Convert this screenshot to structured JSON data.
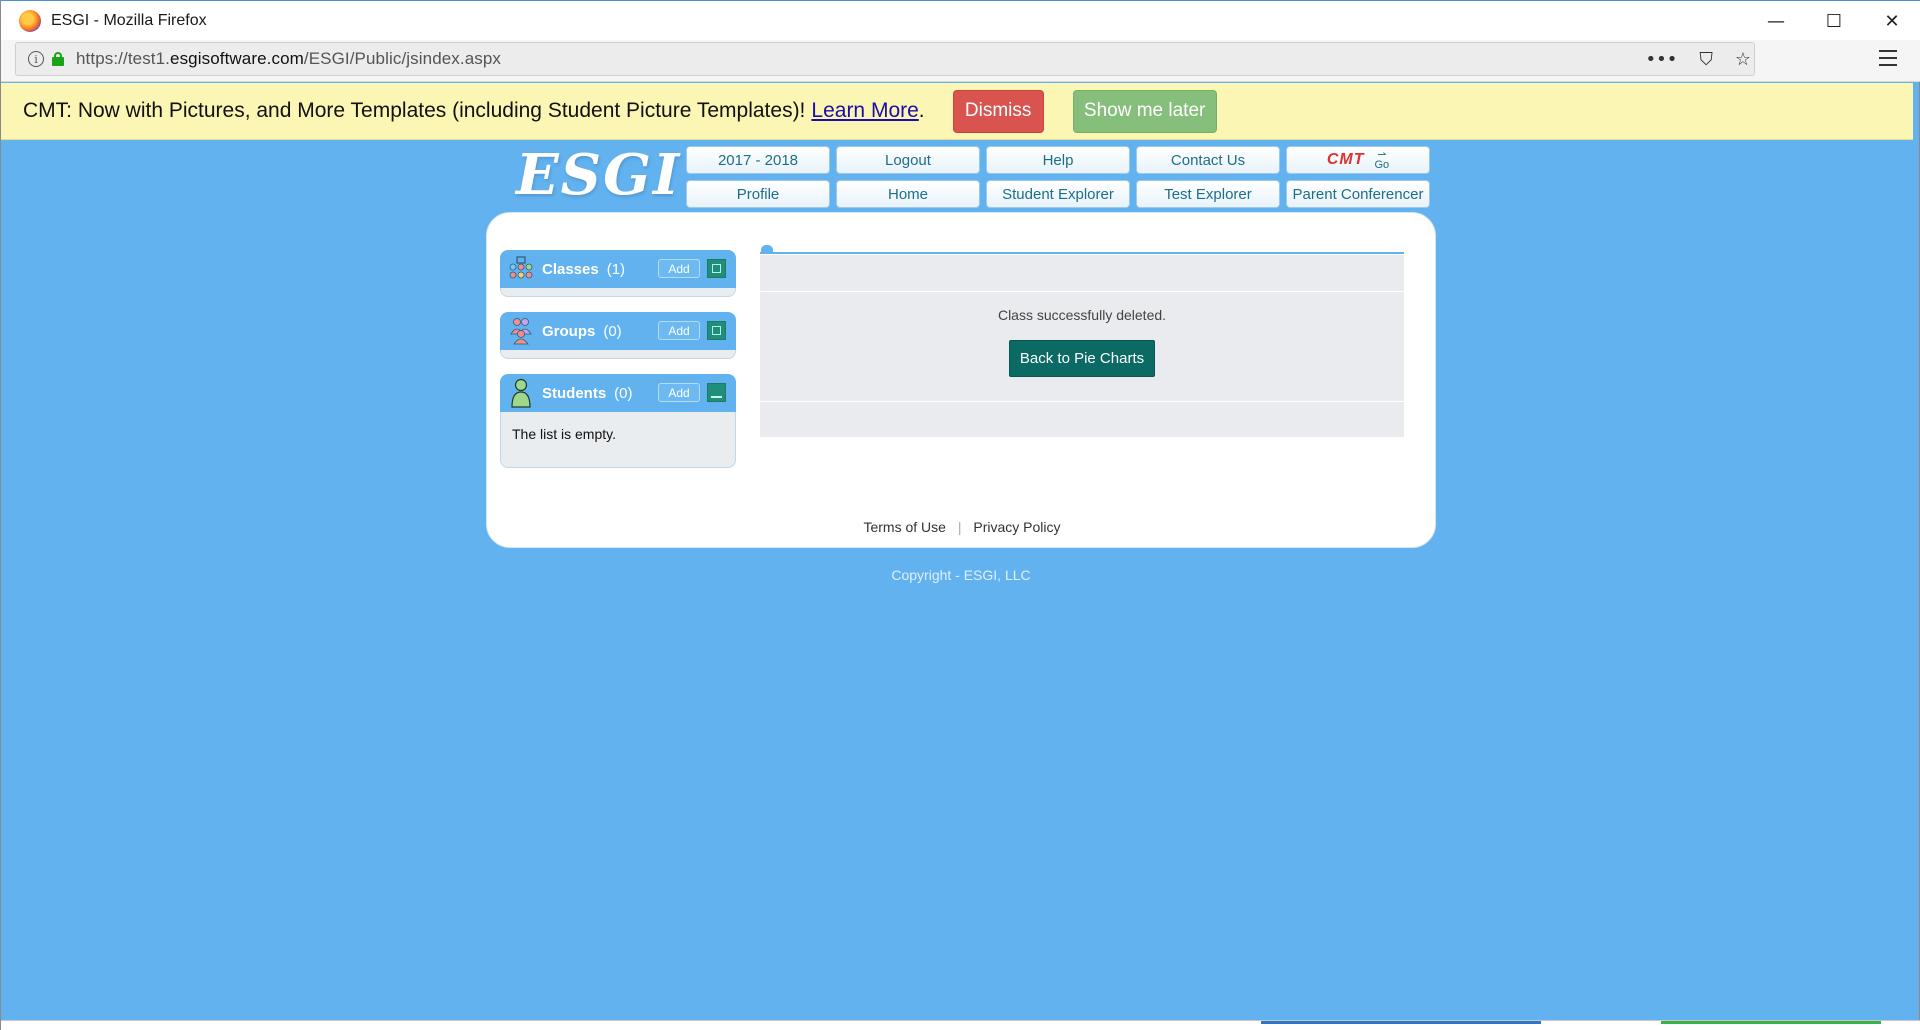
{
  "window": {
    "title": "ESGI - Mozilla Firefox",
    "controls": {
      "minimize": "—",
      "maximize": "☐",
      "close": "✕"
    }
  },
  "browser": {
    "url_prefix": "https://test1.",
    "url_domain": "esgisoftware.com",
    "url_path": "/ESGI/Public/jsindex.aspx",
    "actions": {
      "more": "•••",
      "pocket": "⛉",
      "bookmark": "☆"
    }
  },
  "banner": {
    "message": "CMT: Now with Pictures, and More Templates (including Student Picture Templates)!",
    "learn_more": "Learn More",
    "period": ".",
    "dismiss": "Dismiss",
    "show_later": "Show me later",
    "colors": {
      "dismiss": "#d9534f",
      "show_later": "#86bf7c",
      "background": "#fbf6b4"
    }
  },
  "logo": {
    "text": "ESGI"
  },
  "topnav": {
    "row1": [
      {
        "name": "nav-school-year",
        "label": "2017 - 2018"
      },
      {
        "name": "nav-logout",
        "label": "Logout"
      },
      {
        "name": "nav-help",
        "label": "Help"
      },
      {
        "name": "nav-contact-us",
        "label": "Contact Us"
      }
    ],
    "cmt": {
      "label": "CMT",
      "go": "Go"
    },
    "row2": [
      {
        "name": "nav-profile",
        "label": "Profile"
      },
      {
        "name": "nav-home",
        "label": "Home"
      },
      {
        "name": "nav-student-explorer",
        "label": "Student Explorer"
      },
      {
        "name": "nav-test-explorer",
        "label": "Test Explorer"
      },
      {
        "name": "nav-parent-conferencer",
        "label": "Parent Conferencer"
      }
    ]
  },
  "sidebar": {
    "classes": {
      "label": "Classes",
      "count": "(1)",
      "add": "Add"
    },
    "groups": {
      "label": "Groups",
      "count": "(0)",
      "add": "Add"
    },
    "students": {
      "label": "Students",
      "count": "(0)",
      "add": "Add",
      "empty": "The list is empty."
    }
  },
  "main": {
    "status": "Class successfully deleted.",
    "back_button": "Back to Pie Charts"
  },
  "footer": {
    "terms": "Terms of Use",
    "separator": "|",
    "privacy": "Privacy Policy",
    "copyright": "Copyright - ESGI, LLC"
  },
  "colors": {
    "page_bg": "#62b2f0",
    "accent_teal": "#0b6a64",
    "nav_text": "#1c6e8a"
  }
}
